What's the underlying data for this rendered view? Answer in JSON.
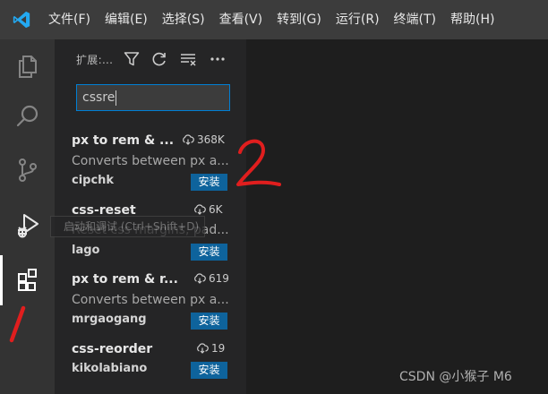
{
  "menubar": {
    "items": [
      "文件(F)",
      "编辑(E)",
      "选择(S)",
      "查看(V)",
      "转到(G)",
      "运行(R)",
      "终端(T)",
      "帮助(H)"
    ]
  },
  "sidebar": {
    "title": "扩展:...",
    "search": {
      "value": "cssre"
    }
  },
  "extensions": [
    {
      "name": "px to rem & ...",
      "downloads": "368K",
      "description": "Converts between px a...",
      "author": "cipchk",
      "install_label": "安装"
    },
    {
      "name": "css-reset",
      "downloads": "6K",
      "description": "Reset css margins, pad...",
      "author": "lago",
      "install_label": "安装"
    },
    {
      "name": "px to rem & r...",
      "downloads": "619",
      "description": "Converts between px a...",
      "author": "mrgaogang",
      "install_label": "安装"
    },
    {
      "name": "css-reorder",
      "downloads": "19",
      "author": "kikolabiano",
      "install_label": "安装"
    }
  ],
  "tooltip": {
    "text": "启动和调试 (Ctrl+Shift+D)"
  },
  "annotations": [
    "2",
    "/"
  ],
  "watermark": "CSDN @小猴子 M6",
  "icons": {
    "activity": [
      "explorer-icon",
      "search-icon",
      "source-control-icon",
      "run-debug-icon",
      "extensions-icon"
    ]
  },
  "colors": {
    "accent": "#007fd4",
    "install": "#0e639c",
    "annotation": "#e01e1e",
    "logo": "#23a9f2"
  }
}
